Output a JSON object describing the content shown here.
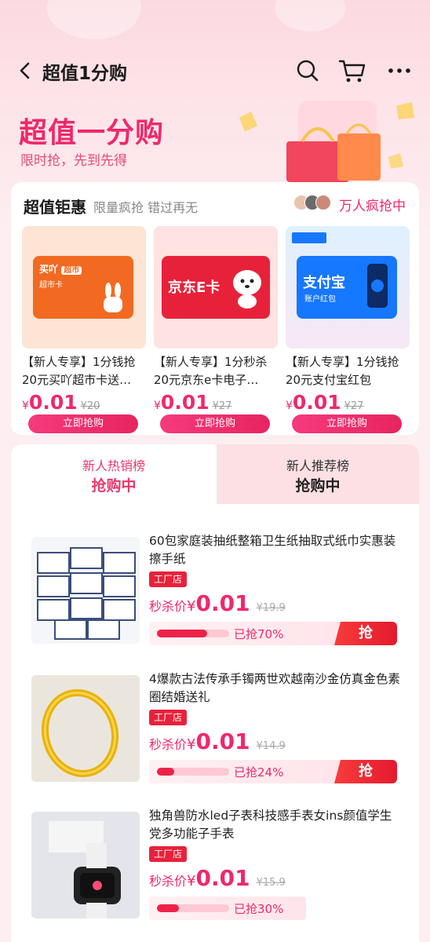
{
  "header": {
    "title": "超值1分购"
  },
  "banner": {
    "title": "超值一分购",
    "subtitle": "限时抢，先到先得"
  },
  "coupons": {
    "title": "超值钜惠",
    "subtitle": "限量疯抢 错过再无",
    "grab_label": "万人疯抢中",
    "items": [
      {
        "name": "【新人专享】1分钱抢20元买吖超市卡送…",
        "yen": "¥",
        "price": "0.01",
        "orig": "¥20",
        "button": "立即抢购",
        "brand_line1": "买吖",
        "brand_line2": "超市",
        "brand_line3": "超市卡"
      },
      {
        "name": "【新人专享】1分秒杀20元京东e卡电子…",
        "yen": "¥",
        "price": "0.01",
        "orig": "¥27",
        "button": "立即抢购",
        "brand_line1": "京东E卡"
      },
      {
        "name": "【新人专享】1分钱抢20元支付宝红包",
        "yen": "¥",
        "price": "0.01",
        "orig": "¥27",
        "button": "立即抢购",
        "brand_line1": "支付宝",
        "brand_line2": "账户红包"
      }
    ]
  },
  "tabs": [
    {
      "name": "新人热销榜",
      "state": "抢购中"
    },
    {
      "name": "新人推荐榜",
      "state": "抢购中"
    }
  ],
  "products": [
    {
      "name": "60包家庭装抽纸整箱卫生纸抽取式纸巾实惠装擦手纸",
      "tag": "工厂店",
      "seckill_label": "秒杀价",
      "yen": "¥",
      "price": "0.01",
      "orig": "¥19.9",
      "progress_text": "已抢70%",
      "progress": 0.7,
      "button": "抢"
    },
    {
      "name": "4爆款古法传承手镯两世欢越南沙金仿真金色素圈结婚送礼",
      "tag": "工厂店",
      "seckill_label": "秒杀价",
      "yen": "¥",
      "price": "0.01",
      "orig": "¥14.9",
      "progress_text": "已抢24%",
      "progress": 0.24,
      "button": "抢"
    },
    {
      "name": "独角兽防水led子表科技感手表女ins颜值学生党多功能子手表",
      "tag": "工厂店",
      "seckill_label": "秒杀价",
      "yen": "¥",
      "price": "0.01",
      "orig": "¥15.9",
      "progress_text": "已抢30%",
      "progress": 0.3,
      "button": ""
    }
  ],
  "colors": {
    "accent": "#f0286a",
    "tab_inactive_bg": "#fde0e3",
    "grab_red": "#e41a2e"
  }
}
